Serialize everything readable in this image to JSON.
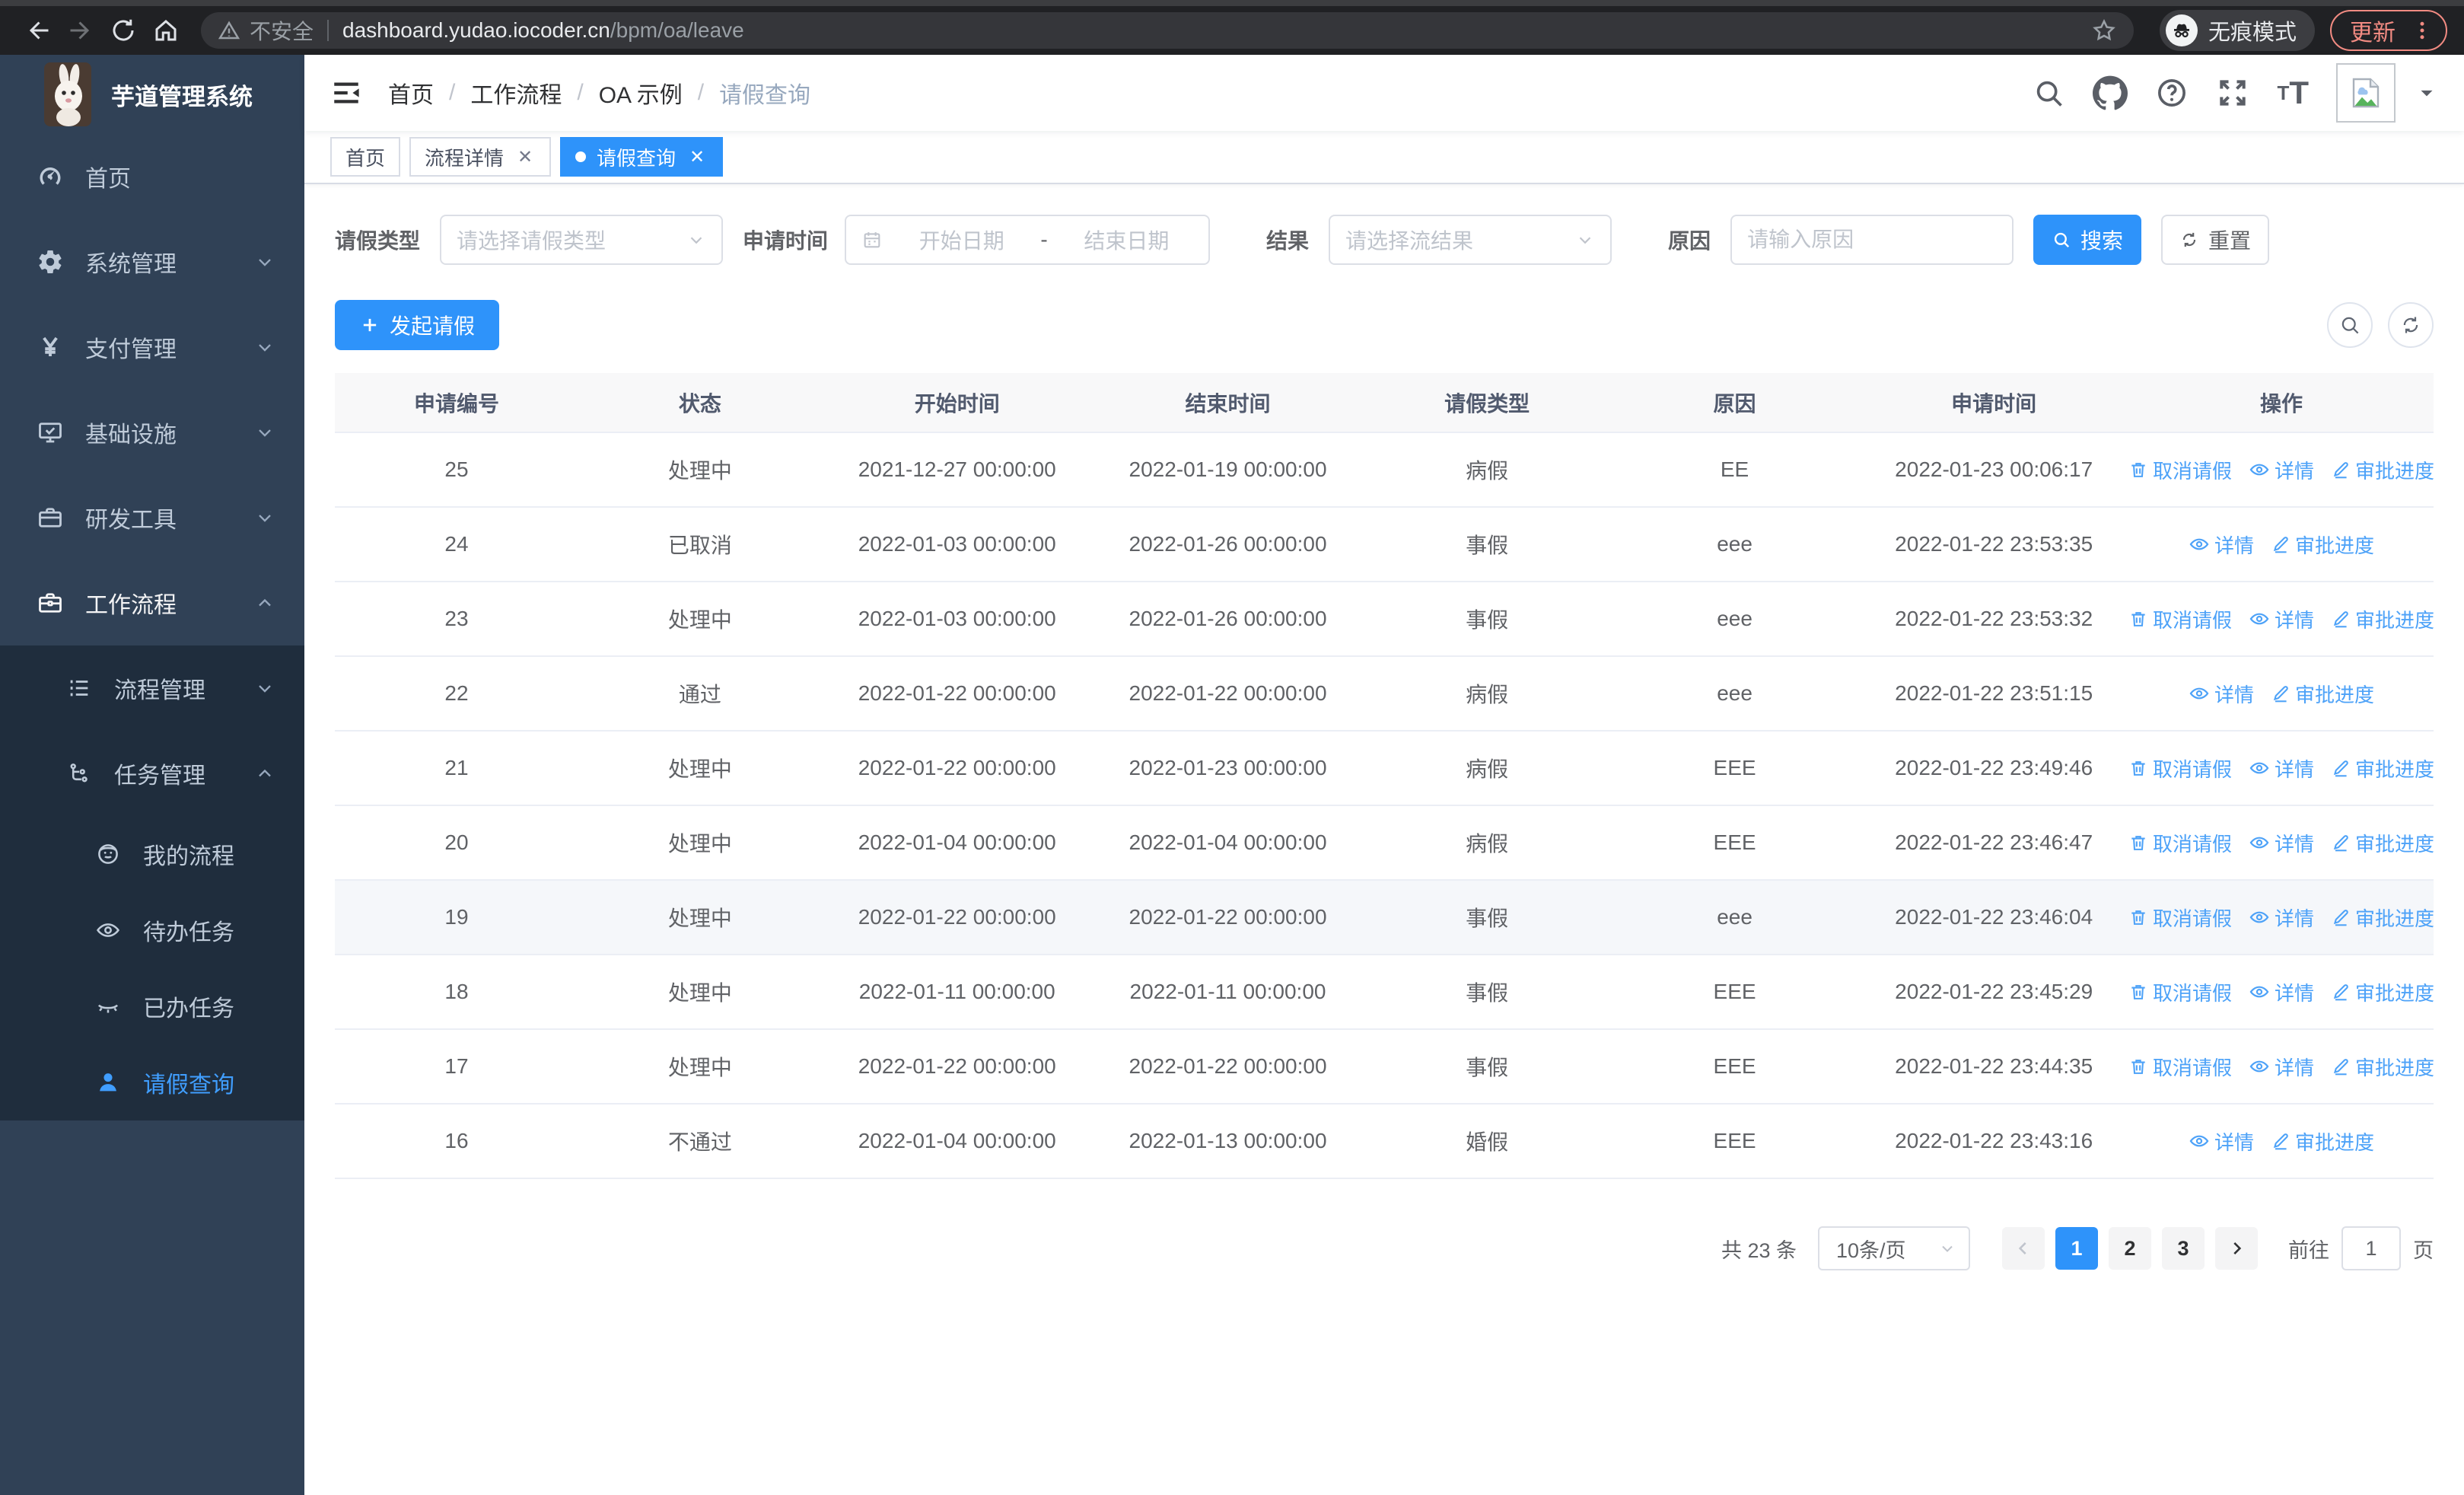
{
  "accent_color": "#2e93fa",
  "link_color": "#4da2f8",
  "browser": {
    "security_label": "不安全",
    "url_host": "dashboard.yudao.iocoder.cn",
    "url_path": "/bpm/oa/leave",
    "incognito_label": "无痕模式",
    "update_label": "更新"
  },
  "sidebar": {
    "app_title": "芋道管理系统",
    "items": [
      {
        "id": "home",
        "icon": "dashboard-icon",
        "label": "首页",
        "level": 0
      },
      {
        "id": "system",
        "icon": "gear-icon",
        "label": "系统管理",
        "level": 0,
        "chevron": "down"
      },
      {
        "id": "payment",
        "icon": "yen-icon",
        "label": "支付管理",
        "level": 0,
        "chevron": "down"
      },
      {
        "id": "infra",
        "icon": "monitor-icon",
        "label": "基础设施",
        "level": 0,
        "chevron": "down"
      },
      {
        "id": "dev-tools",
        "icon": "briefcase-icon",
        "label": "研发工具",
        "level": 0,
        "chevron": "down"
      },
      {
        "id": "workflow",
        "icon": "suitcase-icon",
        "label": "工作流程",
        "level": 0,
        "chevron": "up",
        "open": true
      },
      {
        "id": "process-mgmt",
        "icon": "list-icon",
        "label": "流程管理",
        "level": 1,
        "sub": true,
        "chevron": "down"
      },
      {
        "id": "task-mgmt",
        "icon": "tree-icon",
        "label": "任务管理",
        "level": 1,
        "sub": true,
        "chevron": "up"
      },
      {
        "id": "my-process",
        "icon": "face-icon",
        "label": "我的流程",
        "level": 2,
        "sub": true
      },
      {
        "id": "todo-tasks",
        "icon": "eye-icon",
        "label": "待办任务",
        "level": 2,
        "sub": true
      },
      {
        "id": "done-tasks",
        "icon": "eye-closed-icon",
        "label": "已办任务",
        "level": 2,
        "sub": true
      },
      {
        "id": "leave-query",
        "icon": "user-icon",
        "label": "请假查询",
        "level": 2,
        "sub": true,
        "active": true
      }
    ]
  },
  "breadcrumb": {
    "items": [
      "首页",
      "工作流程",
      "OA 示例",
      "请假查询"
    ]
  },
  "tabs": {
    "items": [
      {
        "label": "首页",
        "closable": false,
        "active": false
      },
      {
        "label": "流程详情",
        "closable": true,
        "active": false
      },
      {
        "label": "请假查询",
        "closable": true,
        "active": true
      }
    ]
  },
  "filters": {
    "leave_type": {
      "label": "请假类型",
      "placeholder": "请选择请假类型"
    },
    "apply_time": {
      "label": "申请时间",
      "start_placeholder": "开始日期",
      "separator": "-",
      "end_placeholder": "结束日期"
    },
    "result": {
      "label": "结果",
      "placeholder": "请选择流结果"
    },
    "reason": {
      "label": "原因",
      "placeholder": "请输入原因"
    },
    "search_label": "搜索",
    "reset_label": "重置"
  },
  "toolbar": {
    "create_label": "发起请假"
  },
  "table": {
    "columns": [
      "申请编号",
      "状态",
      "开始时间",
      "结束时间",
      "请假类型",
      "原因",
      "申请时间",
      "操作"
    ],
    "action_defs": {
      "cancel": {
        "label": "取消请假",
        "icon": "trash-icon"
      },
      "detail": {
        "label": "详情",
        "icon": "eye-icon"
      },
      "progress": {
        "label": "审批进度",
        "icon": "edit-icon"
      }
    },
    "rows": [
      {
        "id": "25",
        "status": "处理中",
        "start": "2021-12-27 00:00:00",
        "end": "2022-01-19 00:00:00",
        "type": "病假",
        "reason": "EE",
        "applied": "2022-01-23 00:06:17",
        "actions": [
          "cancel",
          "detail",
          "progress"
        ]
      },
      {
        "id": "24",
        "status": "已取消",
        "start": "2022-01-03 00:00:00",
        "end": "2022-01-26 00:00:00",
        "type": "事假",
        "reason": "eee",
        "applied": "2022-01-22 23:53:35",
        "actions": [
          "detail",
          "progress"
        ]
      },
      {
        "id": "23",
        "status": "处理中",
        "start": "2022-01-03 00:00:00",
        "end": "2022-01-26 00:00:00",
        "type": "事假",
        "reason": "eee",
        "applied": "2022-01-22 23:53:32",
        "actions": [
          "cancel",
          "detail",
          "progress"
        ]
      },
      {
        "id": "22",
        "status": "通过",
        "start": "2022-01-22 00:00:00",
        "end": "2022-01-22 00:00:00",
        "type": "病假",
        "reason": "eee",
        "applied": "2022-01-22 23:51:15",
        "actions": [
          "detail",
          "progress"
        ]
      },
      {
        "id": "21",
        "status": "处理中",
        "start": "2022-01-22 00:00:00",
        "end": "2022-01-23 00:00:00",
        "type": "病假",
        "reason": "EEE",
        "applied": "2022-01-22 23:49:46",
        "actions": [
          "cancel",
          "detail",
          "progress"
        ]
      },
      {
        "id": "20",
        "status": "处理中",
        "start": "2022-01-04 00:00:00",
        "end": "2022-01-04 00:00:00",
        "type": "病假",
        "reason": "EEE",
        "applied": "2022-01-22 23:46:47",
        "actions": [
          "cancel",
          "detail",
          "progress"
        ]
      },
      {
        "id": "19",
        "status": "处理中",
        "start": "2022-01-22 00:00:00",
        "end": "2022-01-22 00:00:00",
        "type": "事假",
        "reason": "eee",
        "applied": "2022-01-22 23:46:04",
        "actions": [
          "cancel",
          "detail",
          "progress"
        ],
        "highlighted": true
      },
      {
        "id": "18",
        "status": "处理中",
        "start": "2022-01-11 00:00:00",
        "end": "2022-01-11 00:00:00",
        "type": "事假",
        "reason": "EEE",
        "applied": "2022-01-22 23:45:29",
        "actions": [
          "cancel",
          "detail",
          "progress"
        ]
      },
      {
        "id": "17",
        "status": "处理中",
        "start": "2022-01-22 00:00:00",
        "end": "2022-01-22 00:00:00",
        "type": "事假",
        "reason": "EEE",
        "applied": "2022-01-22 23:44:35",
        "actions": [
          "cancel",
          "detail",
          "progress"
        ]
      },
      {
        "id": "16",
        "status": "不通过",
        "start": "2022-01-04 00:00:00",
        "end": "2022-01-13 00:00:00",
        "type": "婚假",
        "reason": "EEE",
        "applied": "2022-01-22 23:43:16",
        "actions": [
          "detail",
          "progress"
        ]
      }
    ]
  },
  "pagination": {
    "total_label": "共 23 条",
    "page_size_label": "10条/页",
    "pages": [
      "1",
      "2",
      "3"
    ],
    "active_page": "1",
    "goto_label": "前往",
    "goto_value": "1",
    "page_unit_label": "页"
  }
}
